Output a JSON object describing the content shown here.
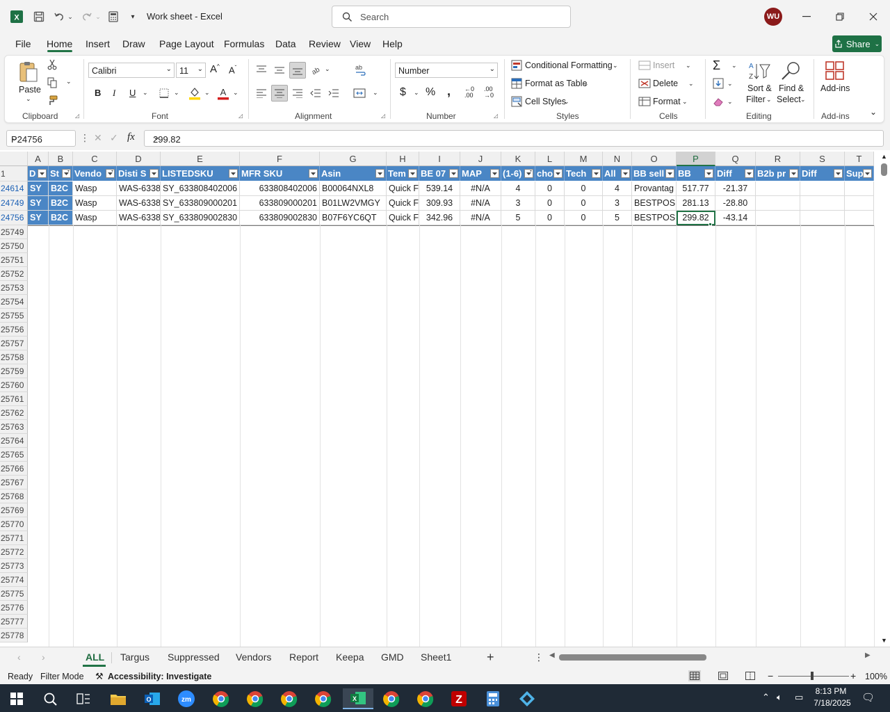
{
  "app": {
    "title": "Work sheet  -  Excel",
    "user_initials": "WU"
  },
  "search": {
    "placeholder": "Search"
  },
  "menu": {
    "items": [
      "File",
      "Home",
      "Insert",
      "Draw",
      "Page Layout",
      "Formulas",
      "Data",
      "Review",
      "View",
      "Help"
    ],
    "share": "Share"
  },
  "ribbon": {
    "clipboard": {
      "label": "Clipboard",
      "paste": "Paste"
    },
    "font": {
      "label": "Font",
      "family": "Calibri",
      "size": "11"
    },
    "alignment": {
      "label": "Alignment"
    },
    "number": {
      "label": "Number",
      "format": "Number"
    },
    "styles": {
      "label": "Styles",
      "conditional": "Conditional Formatting",
      "format_table": "Format as Table",
      "cell_styles": "Cell Styles"
    },
    "cells": {
      "label": "Cells",
      "insert": "Insert",
      "delete": "Delete",
      "format": "Format"
    },
    "editing": {
      "label": "Editing",
      "sort1": "Sort &",
      "sort2": "Filter",
      "find1": "Find &",
      "find2": "Select"
    },
    "addins": {
      "label": "Add-ins",
      "btn": "Add-ins"
    }
  },
  "formula": {
    "namebox": "P24756",
    "value": "299.82"
  },
  "columns": [
    "A",
    "B",
    "C",
    "D",
    "E",
    "F",
    "G",
    "H",
    "I",
    "J",
    "K",
    "L",
    "M",
    "N",
    "O",
    "P",
    "Q",
    "R",
    "S",
    "T"
  ],
  "header_row": {
    "num": "1",
    "cells": [
      "D",
      "St",
      "Vendo",
      "Disti S",
      "LISTEDSKU",
      "MFR SKU",
      "Asin",
      "Tem",
      "BE 07",
      "MAP",
      "(1-6)",
      "cho",
      "Tech",
      "All",
      "BB sell",
      "BB",
      "Diff",
      "B2b pr",
      "Diff",
      "Sup"
    ]
  },
  "data_rows": [
    {
      "num": "24614",
      "cells": [
        "SY",
        "B2C",
        "Wasp",
        "WAS-6338",
        "SY_633808402006",
        "633808402006",
        "B00064NXL8",
        "Quick F",
        "539.14",
        "#N/A",
        "4",
        "0",
        "0",
        "4",
        "Provantag",
        "517.77",
        "-21.37",
        "",
        "",
        ""
      ]
    },
    {
      "num": "24749",
      "cells": [
        "SY",
        "B2C",
        "Wasp",
        "WAS-6338",
        "SY_633809000201",
        "633809000201",
        "B01LW2VMGY",
        "Quick F",
        "309.93",
        "#N/A",
        "3",
        "0",
        "0",
        "3",
        "BESTPOS (",
        "281.13",
        "-28.80",
        "",
        "",
        ""
      ]
    },
    {
      "num": "24756",
      "cells": [
        "SY",
        "B2C",
        "Wasp",
        "WAS-6338",
        "SY_633809002830",
        "633809002830",
        "B07F6YC6QT",
        "Quick F",
        "342.96",
        "#N/A",
        "5",
        "0",
        "0",
        "5",
        "BESTPOS (",
        "299.82",
        "-43.14",
        "",
        "",
        ""
      ]
    }
  ],
  "empty_rows": [
    "25749",
    "25750",
    "25751",
    "25752",
    "25753",
    "25754",
    "25755",
    "25756",
    "25757",
    "25758",
    "25759",
    "25760",
    "25761",
    "25762",
    "25763",
    "25764",
    "25765",
    "25766",
    "25767",
    "25768",
    "25769",
    "25770",
    "25771",
    "25772",
    "25773",
    "25774",
    "25775",
    "25776",
    "25777",
    "25778"
  ],
  "sheets": [
    "ALL",
    "Targus",
    "Suppressed",
    "Vendors",
    "Report",
    "Keepa",
    "GMD",
    "Sheet1"
  ],
  "status": {
    "ready": "Ready",
    "filter": "Filter Mode",
    "accessibility": "Accessibility: Investigate",
    "zoom": "100%"
  },
  "taskbar": {
    "time": "8:13 PM",
    "date": "7/18/2025"
  },
  "colors": {
    "excel_green": "#217346",
    "table_header": "#4a86c5",
    "share_green": "#1e7145"
  }
}
